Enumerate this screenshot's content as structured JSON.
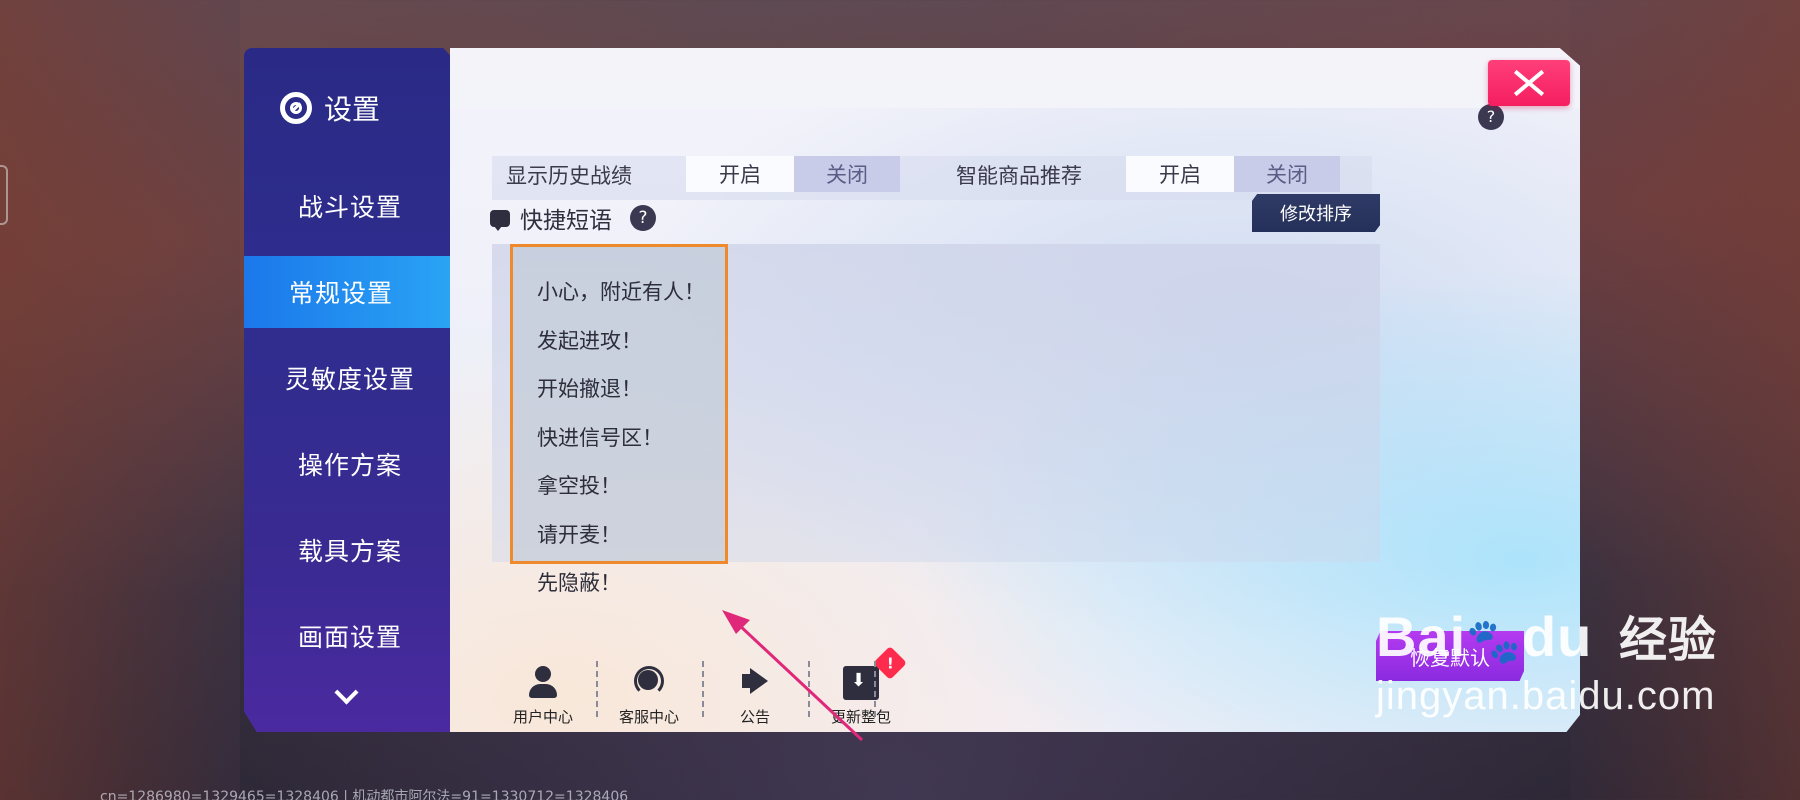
{
  "sidebar": {
    "title": "设置",
    "items": [
      {
        "label": "战斗设置",
        "active": false
      },
      {
        "label": "常规设置",
        "active": true
      },
      {
        "label": "灵敏度设置",
        "active": false
      },
      {
        "label": "操作方案",
        "active": false
      },
      {
        "label": "载具方案",
        "active": false
      },
      {
        "label": "画面设置",
        "active": false
      }
    ]
  },
  "settings_row": {
    "left_label": "显示历史战绩",
    "left_on": "开启",
    "left_off": "关闭",
    "right_label": "智能商品推荐",
    "right_on": "开启",
    "right_off": "关闭",
    "help": "?"
  },
  "quick_phrases": {
    "title": "快捷短语",
    "help": "?",
    "sort_button": "修改排序",
    "phrases": [
      "小心，附近有人！",
      "发起进攻！",
      "开始撤退！",
      "快进信号区！",
      "拿空投！",
      "请开麦！",
      "先隐蔽！"
    ]
  },
  "bottom_bar": {
    "items": [
      {
        "label": "用户中心",
        "icon": "user-icon"
      },
      {
        "label": "客服中心",
        "icon": "headset-icon"
      },
      {
        "label": "公告",
        "icon": "bullhorn-icon"
      },
      {
        "label": "更新整包",
        "icon": "package-download-icon",
        "badge": "!"
      }
    ]
  },
  "reset_button": "恢复默认",
  "watermark": {
    "brand": "Bai",
    "brand_suffix": "du",
    "brand_cn": "经验",
    "url": "jingyan.baidu.com"
  },
  "footer_text": "cn=1286980=1329465=1328406 | 机动都市阿尔法=91=1330712=1328406",
  "colors": {
    "sidebar": "#2f2d8e",
    "active_tab": "#1a74ea",
    "close_button": "#f51e60",
    "reset_button": "#8a2ae0",
    "highlight_box": "#ee8a2c",
    "annotation_arrow": "#e0287a"
  }
}
